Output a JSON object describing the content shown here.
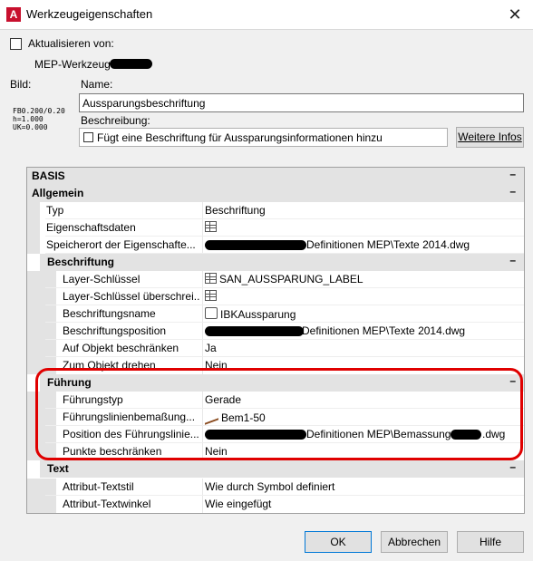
{
  "window": {
    "title": "Werkzeugeigenschaften",
    "close_glyph": "✕"
  },
  "aktualisieren_label": "Aktualisieren von:",
  "tool_source": "MEP-Werkzeuge",
  "bild_label": "Bild:",
  "preview_lines": [
    "FB0.200/0.20",
    "h=1.000",
    "UK=0.000"
  ],
  "name_label": "Name:",
  "name_value": "Aussparungsbeschriftung",
  "beschreibung_label": "Beschreibung:",
  "beschreibung_value": "Fügt eine Beschriftung für Aussparungsinformationen hinzu",
  "weitere_infos": "Weitere Infos",
  "grid": {
    "basis": "BASIS",
    "allgemein": "Allgemein",
    "allgemein_rows": [
      {
        "name": "Typ",
        "value": "Beschriftung"
      },
      {
        "name": "Eigenschaftsdaten",
        "value": ""
      },
      {
        "name": "Speicherort der Eigenschafte...",
        "value": "Definitionen MEP\\Texte 2014.dwg"
      }
    ],
    "beschriftung": "Beschriftung",
    "beschriftung_rows": [
      {
        "name": "Layer-Schlüssel",
        "value": "SAN_AUSSPARUNG_LABEL"
      },
      {
        "name": "Layer-Schlüssel  überschrei...",
        "value": ""
      },
      {
        "name": "Beschriftungsname",
        "value": "IBKAussparung"
      },
      {
        "name": "Beschriftungsposition",
        "value": "Definitionen MEP\\Texte 2014.dwg"
      },
      {
        "name": "Auf Objekt beschränken",
        "value": "Ja"
      },
      {
        "name": "Zum Objekt drehen",
        "value": "Nein"
      }
    ],
    "fuehrung": "Führung",
    "fuehrung_rows": [
      {
        "name": "Führungstyp",
        "value": "Gerade"
      },
      {
        "name": "Führungslinienbemaßung...",
        "value": "Bem1-50"
      },
      {
        "name": "Position des Führungslinie...",
        "value": "Definitionen MEP\\Bemassungsst",
        "suffix": ".dwg"
      },
      {
        "name": "Punkte beschränken",
        "value": "Nein"
      }
    ],
    "text": "Text",
    "text_rows": [
      {
        "name": "Attribut-Textstil",
        "value": "Wie durch Symbol definiert"
      },
      {
        "name": "Attribut-Textwinkel",
        "value": "Wie eingefügt"
      }
    ],
    "collapse_glyph": "–"
  },
  "buttons": {
    "ok": "OK",
    "cancel": "Abbrechen",
    "help": "Hilfe"
  },
  "colors": {
    "highlight": "#e00000",
    "category_bg": "#e3e3e3"
  }
}
